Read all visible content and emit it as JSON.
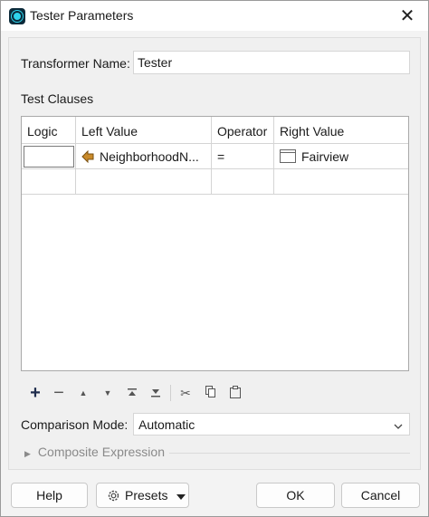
{
  "window": {
    "title": "Tester Parameters",
    "close_glyph": "✕"
  },
  "transformer": {
    "name_label": "Transformer Name:",
    "name_value": "Tester"
  },
  "test_clauses": {
    "section_label": "Test Clauses",
    "columns": [
      "Logic",
      "Left Value",
      "Operator",
      "Right Value"
    ],
    "rows": [
      {
        "logic": "",
        "left_value": "NeighborhoodN...",
        "left_icon": "attribute-arrow-icon",
        "operator": "=",
        "right_value": "Fairview",
        "right_icon": "text-value-icon"
      }
    ]
  },
  "toolbar": {
    "icons": [
      "add-icon",
      "remove-icon",
      "move-up-icon",
      "move-down-icon",
      "move-top-icon",
      "move-bottom-icon",
      "cut-icon",
      "copy-icon",
      "paste-icon"
    ],
    "glyphs": [
      "+",
      "−",
      "▲",
      "▼",
      "",
      "",
      "✂",
      "",
      ""
    ]
  },
  "comparison": {
    "label": "Comparison Mode:",
    "value": "Automatic"
  },
  "composite": {
    "label": "Composite Expression"
  },
  "buttons": {
    "help": "Help",
    "presets": "Presets",
    "ok": "OK",
    "cancel": "Cancel"
  },
  "colors": {
    "accent_icon": "#2fd3ec",
    "attribute_arrow": "#c98a2a"
  }
}
